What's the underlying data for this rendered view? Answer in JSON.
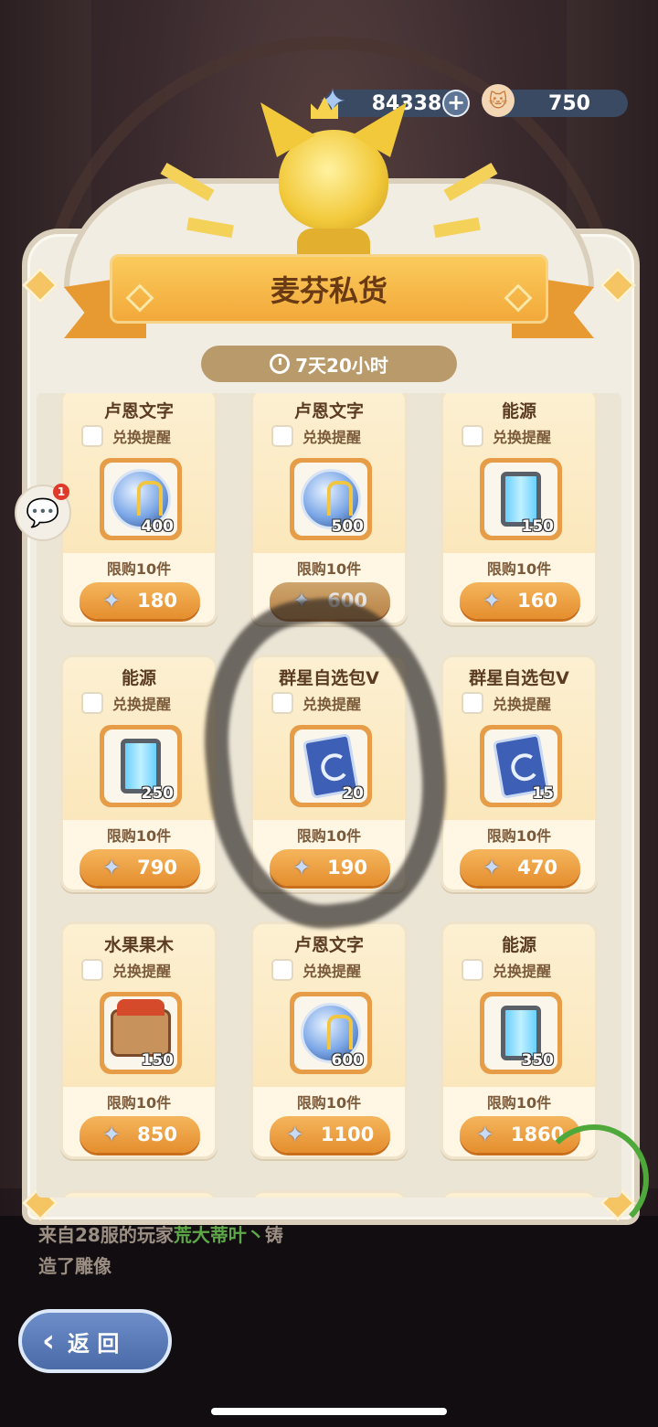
{
  "header": {
    "stars_count": "84338",
    "plus_label": "+",
    "cat_currency_count": "750"
  },
  "shop": {
    "title": "麦芬私货",
    "timer": "7天20小时"
  },
  "items": [
    {
      "name": "卢恩文字",
      "remind": "兑换提醒",
      "qty": "400",
      "limit": "限购10件",
      "price": "180",
      "art": "rune-orb"
    },
    {
      "name": "卢恩文字",
      "remind": "兑换提醒",
      "qty": "500",
      "limit": "限购10件",
      "price": "600",
      "art": "rune-orb"
    },
    {
      "name": "能源",
      "remind": "兑换提醒",
      "qty": "150",
      "limit": "限购10件",
      "price": "160",
      "art": "energy-battery"
    },
    {
      "name": "能源",
      "remind": "兑换提醒",
      "qty": "250",
      "limit": "限购10件",
      "price": "790",
      "art": "energy-battery"
    },
    {
      "name": "群星自选包V",
      "remind": "兑换提醒",
      "qty": "20",
      "limit": "限购10件",
      "price": "190",
      "art": "star-card"
    },
    {
      "name": "群星自选包V",
      "remind": "兑换提醒",
      "qty": "15",
      "limit": "限购10件",
      "price": "470",
      "art": "star-card"
    },
    {
      "name": "水果果木",
      "remind": "兑换提醒",
      "qty": "150",
      "limit": "限购10件",
      "price": "850",
      "art": "fruit-log"
    },
    {
      "name": "卢恩文字",
      "remind": "兑换提醒",
      "qty": "600",
      "limit": "限购10件",
      "price": "1100",
      "art": "rune-orb"
    },
    {
      "name": "能源",
      "remind": "兑换提醒",
      "qty": "350",
      "limit": "限购10件",
      "price": "1860",
      "art": "energy-battery"
    }
  ],
  "chat": {
    "badge": "1"
  },
  "feed": {
    "prefix": "来自28服的玩家",
    "player": "荒大蒂叶丶",
    "suffix": "铸",
    "line2": "造了雕像"
  },
  "back_button": {
    "label": "返 回"
  },
  "colors": {
    "accent_orange": "#e48e2e",
    "banner_gold": "#f2a93a",
    "panel_bg": "#f1ede3"
  }
}
